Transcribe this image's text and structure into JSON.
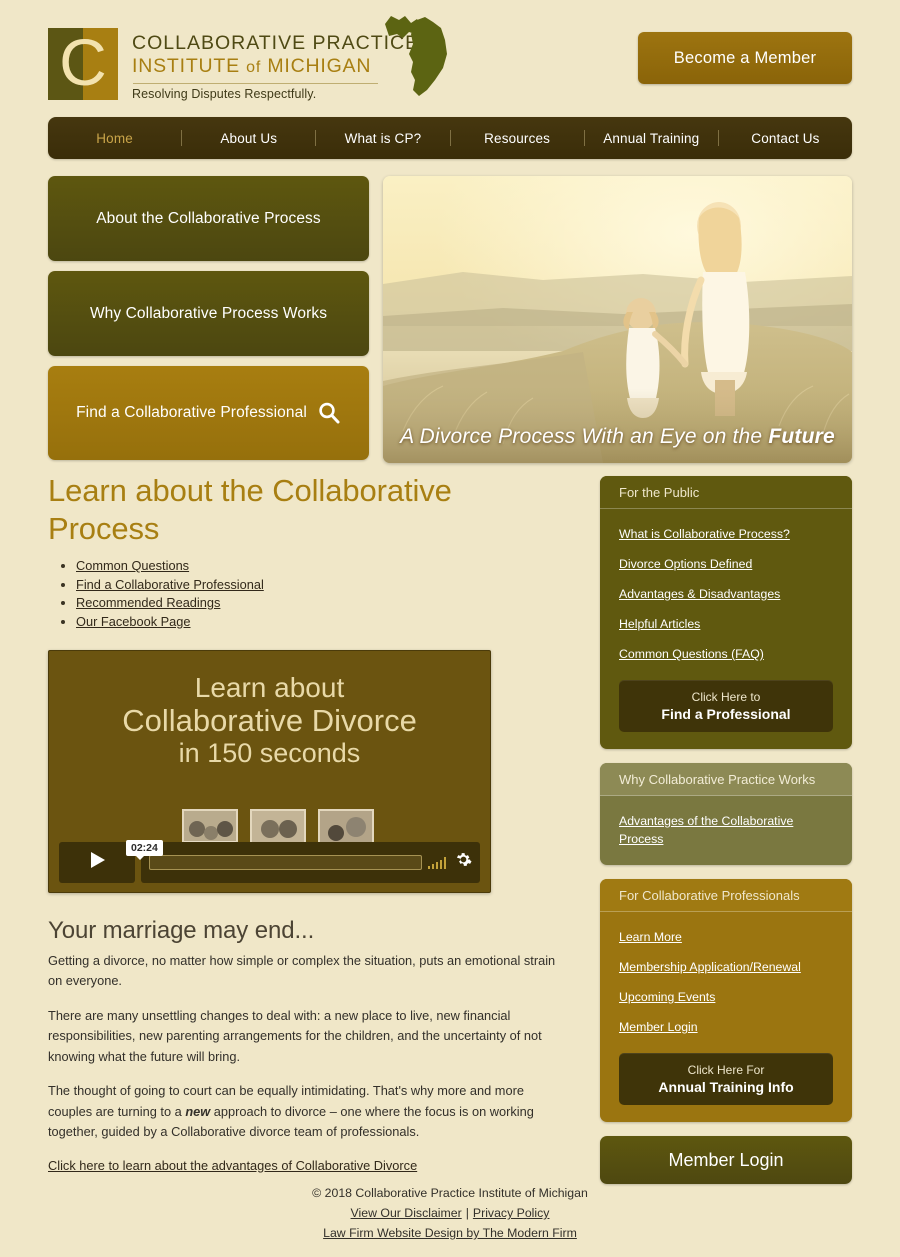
{
  "header": {
    "logo": {
      "mark_letter": "C",
      "line1": "COLLABORATIVE PRACTICE",
      "line2_a": "INSTITUTE",
      "line2_b": "of",
      "line2_c": "MICHIGAN",
      "tagline": "Resolving Disputes Respectfully.",
      "michigan_icon": "michigan-state-outline-icon"
    },
    "member_button": "Become a Member"
  },
  "nav": {
    "items": [
      {
        "label": "Home",
        "active": true
      },
      {
        "label": "About Us",
        "active": false
      },
      {
        "label": "What is CP?",
        "active": false
      },
      {
        "label": "Resources",
        "active": false
      },
      {
        "label": "Annual Training",
        "active": false
      },
      {
        "label": "Contact Us",
        "active": false
      }
    ]
  },
  "features": [
    {
      "label": "About the Collaborative Process",
      "style": "olive",
      "icon": ""
    },
    {
      "label": "Why Collaborative Process Works",
      "style": "olive",
      "icon": ""
    },
    {
      "label": "Find a Collaborative Professional",
      "style": "gold",
      "icon": "search-icon"
    }
  ],
  "hero": {
    "caption_normal": "A Divorce Process With an Eye on the ",
    "caption_bold": "Future",
    "alt": "mother and daughter holding hands at sunset"
  },
  "main": {
    "title": "Learn about the Collaborative Process",
    "links": [
      "Common Questions",
      "Find a Collaborative Professional",
      "Recommended Readings",
      "Our Facebook Page"
    ],
    "video": {
      "line1": "Learn about",
      "line2": "Collaborative Divorce",
      "line3": "in 150 seconds",
      "time_tooltip": "02:24",
      "play_icon": "play-icon",
      "volume_icon": "volume-bars-icon",
      "settings_icon": "gear-icon"
    },
    "subtitle": "Your marriage may end...",
    "paragraph1": "Getting a divorce, no matter how simple or complex the situation, puts an emotional strain on everyone.",
    "paragraph2": "There are many unsettling changes to deal with: a new place to live, new financial responsibilities, new parenting arrangements for the children, and the uncertainty of not knowing what the future will bring.",
    "paragraph3_a": "The thought of going to court can be equally intimidating. That's why more and more couples are turning to a ",
    "paragraph3_em": "new",
    "paragraph3_b": " approach to divorce – one where the focus is on working together, guided by a Collaborative divorce team of professionals.",
    "bottom_link": "Click here to learn about the advantages of Collaborative Divorce"
  },
  "sidebar": {
    "widgets": [
      {
        "title": "For the Public",
        "style": "olive",
        "links": [
          "What is Collaborative Process?",
          "Divorce Options Defined",
          "Advantages & Disadvantages",
          "Helpful Articles",
          "Common Questions (FAQ)"
        ],
        "cta_small": "Click Here to",
        "cta_big": "Find a Professional"
      },
      {
        "title": "Why Collaborative Practice Works",
        "style": "lightolive",
        "links": [
          "Advantages of the Collaborative Process"
        ],
        "cta_small": "",
        "cta_big": ""
      },
      {
        "title": "For Collaborative Professionals",
        "style": "gold",
        "links": [
          "Learn More",
          "Membership Application/Renewal",
          "Upcoming Events",
          "Member Login"
        ],
        "cta_small": "Click Here For",
        "cta_big": "Annual Training Info"
      }
    ],
    "login_button": "Member Login"
  },
  "footer": {
    "copyright": "© 2018 Collaborative Practice Institute of Michigan",
    "disclaimer_link": "View Our Disclaimer",
    "separator": "|",
    "privacy_link": "Privacy Policy",
    "credit_link": "Law Firm Website Design by The Modern Firm"
  },
  "colors": {
    "page_bg": "#f0e7c8",
    "olive": "#5c5614",
    "gold": "#a87f12",
    "nav_brown": "#42340d",
    "light_olive": "#7a7840"
  }
}
